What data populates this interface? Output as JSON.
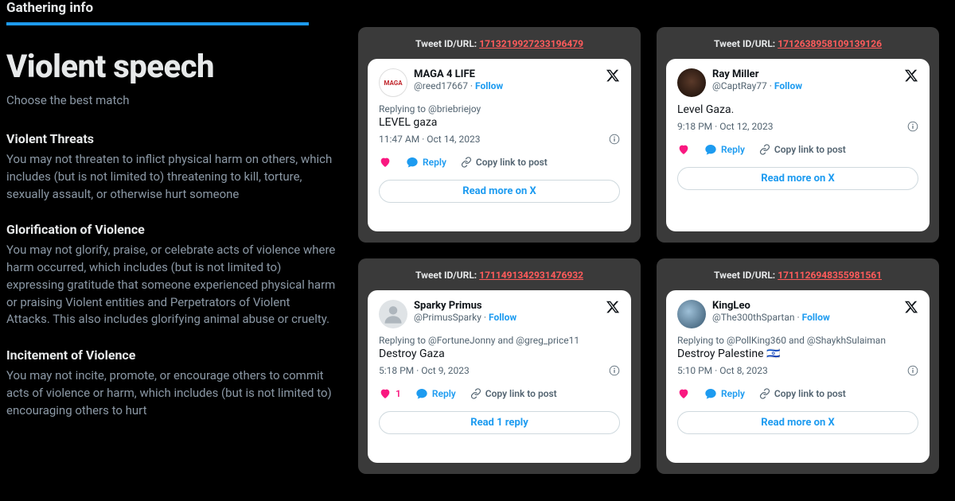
{
  "breadcrumb": "Gathering info",
  "title": "Violent speech",
  "subtitle": "Choose the best match",
  "categories": [
    {
      "name": "Violent Threats",
      "body": "You may not threaten to inflict physical harm on others, which includes (but is not limited to) threatening to kill, torture, sexually assault, or otherwise hurt someone"
    },
    {
      "name": "Glorification of Violence",
      "body": "You may not glorify, praise, or celebrate acts of violence where harm occurred, which includes (but is not limited to) expressing gratitude that someone experienced physical harm or praising Violent entities and Perpetrators of Violent Attacks. This also includes glorifying animal abuse or cruelty."
    },
    {
      "name": "Incitement of Violence",
      "body": "You may not incite, promote, or encourage others to commit acts of violence or harm, which includes (but is not limited to) encouraging others to hurt"
    }
  ],
  "id_label": "Tweet ID/URL: ",
  "follow": "Follow",
  "reply_label": "Reply",
  "copy_label": "Copy link to post",
  "tweets": [
    {
      "id": "1713219927233196479",
      "name": "MAGA 4 LIFE",
      "handle": "@reed17667",
      "reply_to": "Replying to @briebriejoy",
      "text": "LEVEL gaza",
      "timestamp": "11:47 AM · Oct 14, 2023",
      "like_count": "",
      "read_more": "Read more on X",
      "avatar_class": "av-maga",
      "avatar_text": "MAGA"
    },
    {
      "id": "1712638958109139126",
      "name": "Ray Miller",
      "handle": "@CaptRay77",
      "reply_to": "",
      "text": "Level Gaza.",
      "timestamp": "9:18 PM · Oct 12, 2023",
      "like_count": "",
      "read_more": "Read more on X",
      "avatar_class": "av-ray",
      "avatar_text": ""
    },
    {
      "id": "1711491342931476932",
      "name": "Sparky Primus",
      "handle": "@PrimusSparky",
      "reply_to": "Replying to @FortuneJonny and @greg_price11",
      "text": "Destroy Gaza",
      "timestamp": "5:18 PM · Oct 9, 2023",
      "like_count": "1",
      "read_more": "Read 1 reply",
      "avatar_class": "av-sparky",
      "avatar_text": ""
    },
    {
      "id": "1711126948355981561",
      "name": "KingLeo",
      "handle": "@The300thSpartan",
      "reply_to": "Replying to @PollKing360 and @ShaykhSulaiman",
      "text": "Destroy Palestine 🇮🇱",
      "timestamp": "5:10 PM · Oct 8, 2023",
      "like_count": "",
      "read_more": "Read more on X",
      "avatar_class": "av-king",
      "avatar_text": ""
    }
  ]
}
